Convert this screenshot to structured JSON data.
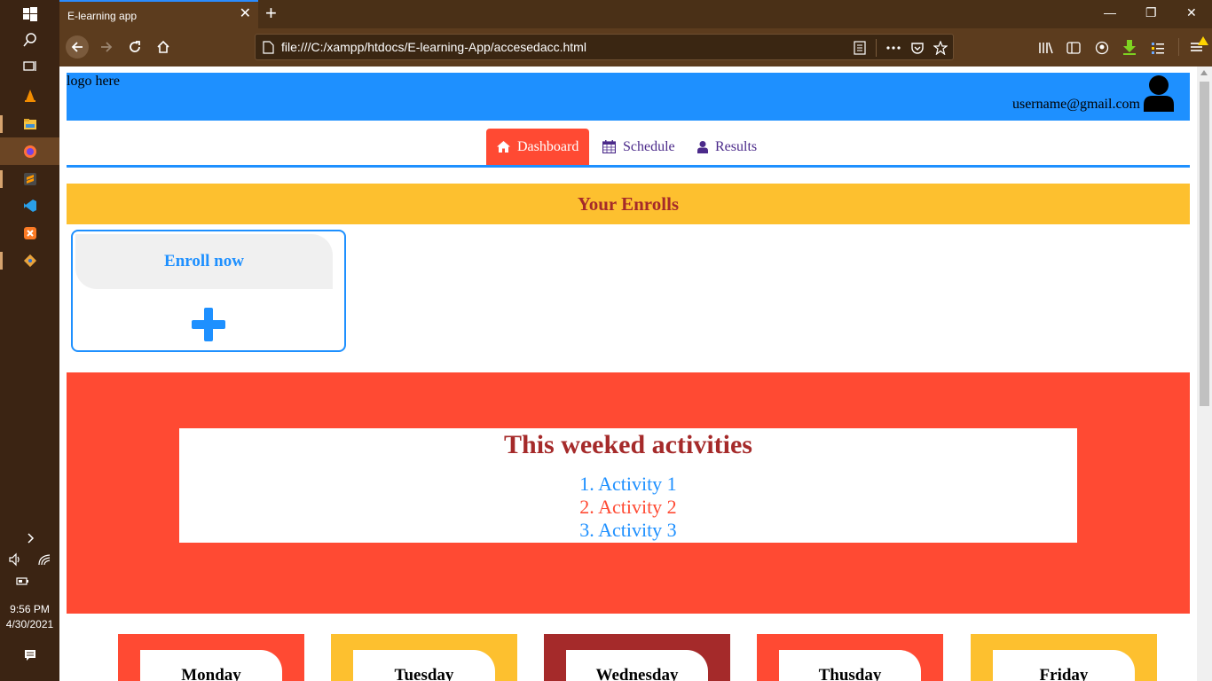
{
  "taskbar": {
    "time": "9:56 PM",
    "date": "4/30/2021"
  },
  "browser": {
    "tab_title": "E-learning app",
    "url": "file:///C:/xampp/htdocs/E-learning-App/accesedacc.html"
  },
  "page": {
    "logo": "logo here",
    "user_email": "username@gmail.com",
    "nav_tabs": [
      {
        "label": "Dashboard",
        "icon": "home-icon",
        "active": true
      },
      {
        "label": "Schedule",
        "icon": "calendar-icon",
        "active": false
      },
      {
        "label": "Results",
        "icon": "user-icon",
        "active": false
      }
    ],
    "enrolls_title": "Your Enrolls",
    "enroll_card": {
      "label": "Enroll now",
      "icon": "plus-icon"
    },
    "activities": {
      "title": "This weeked activities",
      "items": [
        {
          "text": "1. Activity 1",
          "color": "#1e90ff"
        },
        {
          "text": "2. Activity 2",
          "color": "#ff4a33"
        },
        {
          "text": "3. Activity 3",
          "color": "#1e90ff"
        }
      ]
    },
    "days": [
      {
        "label": "Monday",
        "color": "#ff4a33"
      },
      {
        "label": "Tuesday",
        "color": "#fdc02f"
      },
      {
        "label": "Wednesday",
        "color": "#a52a2a"
      },
      {
        "label": "Thusday",
        "color": "#ff4a33"
      },
      {
        "label": "Friday",
        "color": "#fdc02f"
      }
    ]
  },
  "colors": {
    "primary_blue": "#1e90ff",
    "accent_red": "#ff4a33",
    "accent_yellow": "#fdc02f",
    "title_brown": "#a52a2a"
  }
}
